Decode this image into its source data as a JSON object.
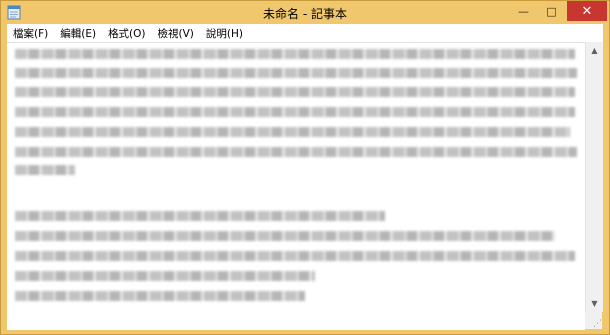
{
  "window": {
    "title": "未命名 - 記事本",
    "minimize_glyph": "—",
    "maximize_glyph": "□",
    "close_glyph": "✕"
  },
  "menu": [
    {
      "label": "檔案(F)"
    },
    {
      "label": "編輯(E)"
    },
    {
      "label": "格式(O)"
    },
    {
      "label": "檢視(V)"
    },
    {
      "label": "說明(H)"
    }
  ],
  "editor": {
    "content_state": "blurred"
  },
  "icons": {
    "app": "notepad-icon",
    "scroll_up": "scroll-up-icon",
    "scroll_down": "scroll-down-icon"
  },
  "colors": {
    "frame": "#f1c76e",
    "close_button": "#c7372f",
    "editor_bg": "#ffffff"
  }
}
